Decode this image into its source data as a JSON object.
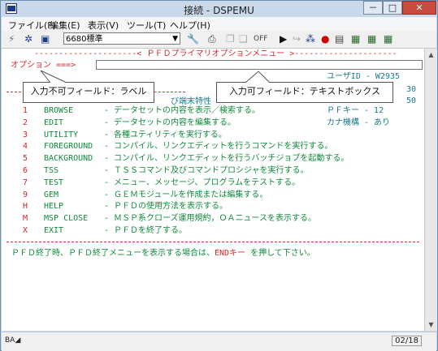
{
  "window": {
    "title": "接続 - DSPEMU",
    "minimize": "－",
    "maximize": "□",
    "close": "✕"
  },
  "menu": [
    "ファイル(F)",
    "編集(E)",
    "表示(V)",
    "ツール(T)",
    "ヘルプ(H)"
  ],
  "toolbar": {
    "codepage": "6680標準"
  },
  "screen": {
    "header": "---------------------< ＰＦＤプライマリオプションメニュー >---------------------",
    "option_label": "オプション ===>",
    "option_value": "",
    "user_info_1": "ユーザID - W2935",
    "user_info_2": "30",
    "user_info_3": "50",
    "partial_line": "び端末特性",
    "menu_items": [
      {
        "key": "1",
        "name": "BROWSE",
        "desc": "- データセットの内容を表示／検索する。",
        "extra": "ＰＦキー - 12"
      },
      {
        "key": "2",
        "name": "EDIT",
        "desc": "- データセットの内容を編集する。",
        "extra": "カナ機構 - あり"
      },
      {
        "key": "3",
        "name": "UTILITY",
        "desc": "- 各種ユティリティを実行する。",
        "extra": ""
      },
      {
        "key": "4",
        "name": "FOREGROUND",
        "desc": "- コンパイル、リンクエディットを行うコマンドを実行する。",
        "extra": ""
      },
      {
        "key": "5",
        "name": "BACKGROUND",
        "desc": "- コンパイル、リンクエディットを行うバッチジョブを起動する。",
        "extra": ""
      },
      {
        "key": "6",
        "name": "TSS",
        "desc": "- ＴＳＳコマンド及びコマンドプロシジャを実行する。",
        "extra": ""
      },
      {
        "key": "7",
        "name": "TEST",
        "desc": "- メニュー、メッセージ、プログラムをテストする。",
        "extra": ""
      },
      {
        "key": "9",
        "name": "GEM",
        "desc": "- ＧＥＭモジュールを作成または編集する。",
        "extra": ""
      },
      {
        "key": "H",
        "name": "HELP",
        "desc": "- ＰＦＤの使用方法を表示する。",
        "extra": ""
      },
      {
        "key": "M",
        "name": "MSP CLOSE",
        "desc": "- ＭＳＰ系クローズ運用規約，ＯＡニュースを表示する。",
        "extra": ""
      },
      {
        "key": "X",
        "name": "EXIT",
        "desc": "- ＰＦＤを終了する。",
        "extra": ""
      }
    ],
    "footer_1": "ＰＦＤ終了時、ＰＦＤ終了メニューを表示する場合は、",
    "footer_key": "ENDキー",
    "footer_2": "を押して下さい。"
  },
  "callouts": {
    "label": "入力不可フィールド：ラベル",
    "textbox": "入力可フィールド：テキストボックス"
  },
  "status": {
    "left": "BA◢",
    "position": "02/18"
  }
}
